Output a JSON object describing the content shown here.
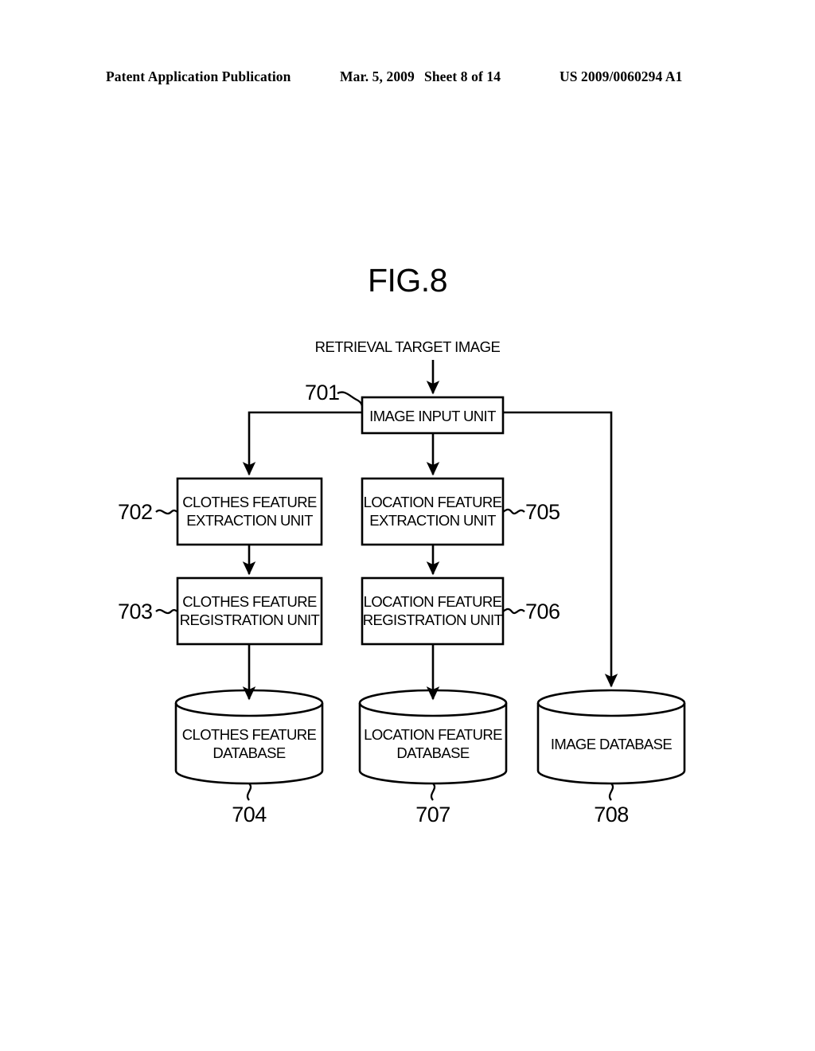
{
  "header": {
    "publication": "Patent Application Publication",
    "date": "Mar. 5, 2009",
    "sheet": "Sheet 8 of 14",
    "patent_number": "US 2009/0060294 A1"
  },
  "figure": {
    "title": "FIG.8",
    "input_caption": "RETRIEVAL TARGET IMAGE"
  },
  "nodes": {
    "image_input_unit": {
      "ref": "701",
      "line1": "IMAGE INPUT UNIT",
      "line2": ""
    },
    "clothes_feature_extraction_unit": {
      "ref": "702",
      "line1": "CLOTHES FEATURE",
      "line2": "EXTRACTION UNIT"
    },
    "clothes_feature_registration_unit": {
      "ref": "703",
      "line1": "CLOTHES FEATURE",
      "line2": "REGISTRATION UNIT"
    },
    "clothes_feature_database": {
      "ref": "704",
      "line1": "CLOTHES FEATURE",
      "line2": "DATABASE"
    },
    "location_feature_extraction_unit": {
      "ref": "705",
      "line1": "LOCATION FEATURE",
      "line2": "EXTRACTION UNIT"
    },
    "location_feature_registration_unit": {
      "ref": "706",
      "line1": "LOCATION FEATURE",
      "line2": "REGISTRATION UNIT"
    },
    "location_feature_database": {
      "ref": "707",
      "line1": "LOCATION FEATURE",
      "line2": "DATABASE"
    },
    "image_database": {
      "ref": "708",
      "line1": "IMAGE DATABASE",
      "line2": ""
    }
  },
  "colors": {
    "ink": "#000000",
    "paper": "#ffffff"
  }
}
